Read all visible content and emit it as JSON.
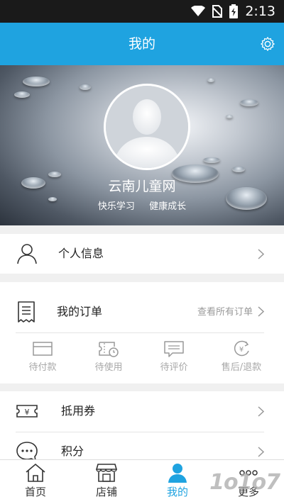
{
  "status_bar": {
    "time": "2:13"
  },
  "header": {
    "title": "我的",
    "settings_icon": "gear-icon"
  },
  "profile": {
    "name": "云南儿童网",
    "tags": [
      "快乐学习",
      "健康成长"
    ]
  },
  "menu": {
    "personal_info": {
      "label": "个人信息",
      "icon": "person-icon"
    },
    "orders": {
      "label": "我的订单",
      "icon": "receipt-icon",
      "view_all": "查看所有订单",
      "statuses": [
        {
          "label": "待付款",
          "icon": "card-icon"
        },
        {
          "label": "待使用",
          "icon": "ticket-clock-icon"
        },
        {
          "label": "待评价",
          "icon": "comment-icon"
        },
        {
          "label": "售后/退款",
          "icon": "refund-icon"
        }
      ]
    },
    "coupon": {
      "label": "抵用券",
      "icon": "coupon-icon"
    },
    "points": {
      "label": "积分",
      "icon": "chat-dots-icon"
    }
  },
  "tabs": [
    {
      "label": "首页",
      "icon": "home-icon"
    },
    {
      "label": "店铺",
      "icon": "shop-icon"
    },
    {
      "label": "我的",
      "icon": "user-icon",
      "active": true
    },
    {
      "label": "更多",
      "icon": "more-icon"
    }
  ],
  "colors": {
    "accent": "#1fa3e0",
    "statusbar": "#1a1a1a"
  }
}
